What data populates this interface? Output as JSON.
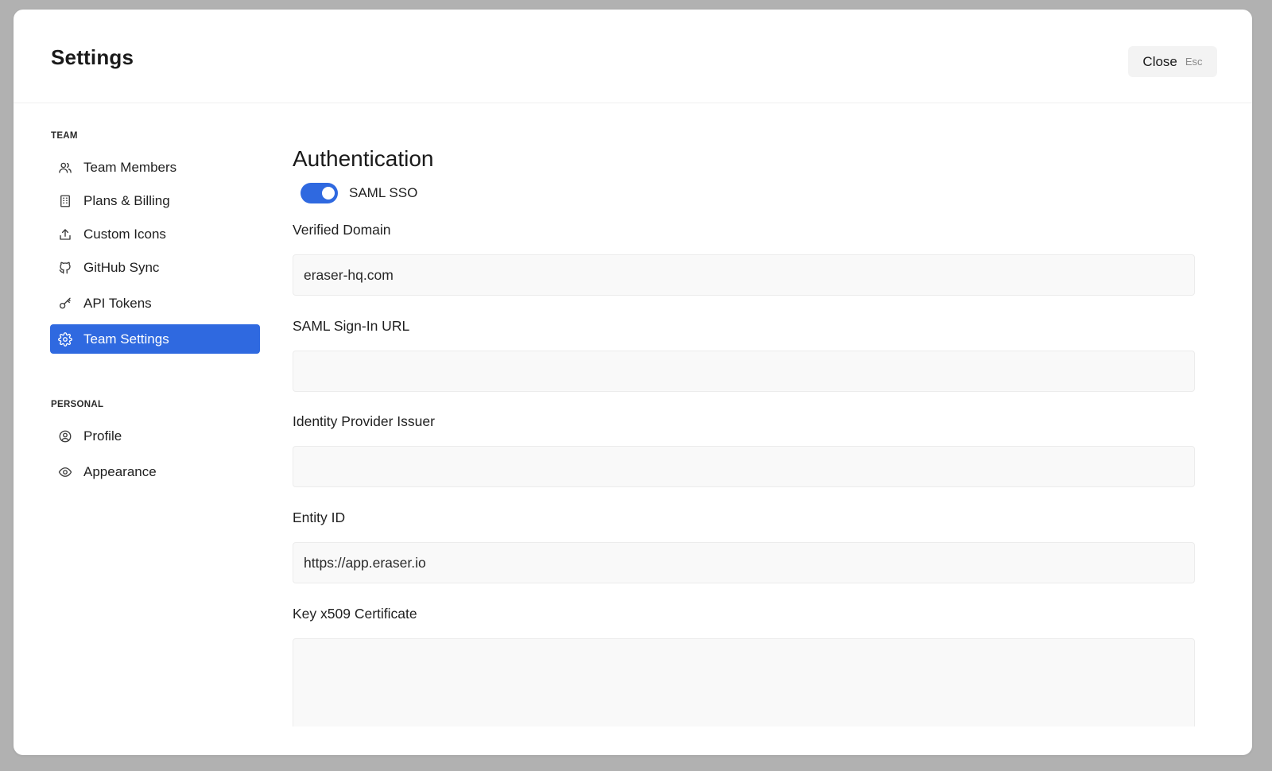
{
  "modal": {
    "title": "Settings",
    "close_label": "Close",
    "close_shortcut": "Esc"
  },
  "sidebar": {
    "team_section": "TEAM",
    "team_items": [
      {
        "label": "Team Members",
        "icon": "users-icon"
      },
      {
        "label": "Plans & Billing",
        "icon": "receipt-icon"
      },
      {
        "label": "Custom Icons",
        "icon": "upload-icon"
      },
      {
        "label": "GitHub Sync",
        "icon": "github-icon"
      },
      {
        "label": "API Tokens",
        "icon": "key-icon"
      },
      {
        "label": "Team Settings",
        "icon": "gear-icon",
        "active": true
      }
    ],
    "personal_section": "PERSONAL",
    "personal_items": [
      {
        "label": "Profile",
        "icon": "user-circle-icon"
      },
      {
        "label": "Appearance",
        "icon": "eye-icon"
      }
    ]
  },
  "main": {
    "section_title": "Authentication",
    "saml_toggle": {
      "label": "SAML SSO",
      "enabled": true
    },
    "fields": {
      "verified_domain": {
        "label": "Verified Domain",
        "value": "eraser-hq.com"
      },
      "saml_signin_url": {
        "label": "SAML Sign-In URL",
        "value": ""
      },
      "idp_issuer": {
        "label": "Identity Provider Issuer",
        "value": ""
      },
      "entity_id": {
        "label": "Entity ID",
        "value": "https://app.eraser.io"
      },
      "x509_cert": {
        "label": "Key x509 Certificate",
        "value": ""
      }
    }
  },
  "colors": {
    "accent": "#2f69e0",
    "backdrop": "#b1b1b1",
    "input_bg": "#f9f9f9"
  }
}
